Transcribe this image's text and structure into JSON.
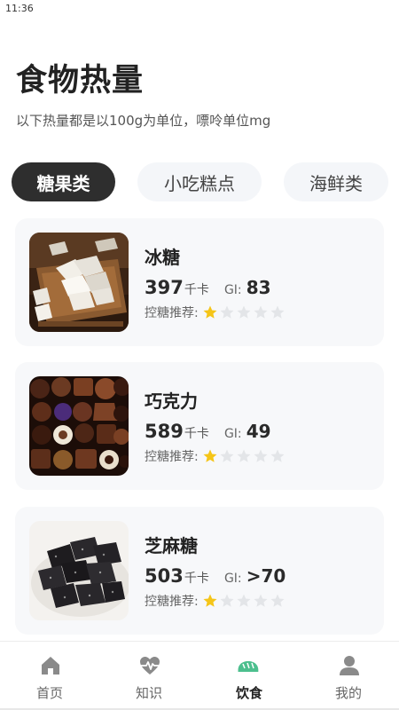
{
  "status_bar": {
    "time": "11:36"
  },
  "header": {
    "title": "食物热量",
    "subtitle": "以下热量都是以100g为单位，嘌呤单位mg"
  },
  "tabs": [
    {
      "label": "糖果类",
      "active": true
    },
    {
      "label": "小吃糕点",
      "active": false
    },
    {
      "label": "海鲜类",
      "active": false
    }
  ],
  "foods": [
    {
      "name": "冰糖",
      "kcal": "397",
      "kcal_unit": "千卡",
      "gi_label": "GI:",
      "gi": "83",
      "recommend_label": "控糖推荐:",
      "rating": 1,
      "rating_max": 5,
      "image": "rock-sugar-photo"
    },
    {
      "name": "巧克力",
      "kcal": "589",
      "kcal_unit": "千卡",
      "gi_label": "GI:",
      "gi": "49",
      "recommend_label": "控糖推荐:",
      "rating": 1,
      "rating_max": 5,
      "image": "chocolate-photo"
    },
    {
      "name": "芝麻糖",
      "kcal": "503",
      "kcal_unit": "千卡",
      "gi_label": "GI:",
      "gi": ">70",
      "recommend_label": "控糖推荐:",
      "rating": 1,
      "rating_max": 5,
      "image": "sesame-candy-photo"
    }
  ],
  "bottom_nav": [
    {
      "label": "首页",
      "icon": "home-icon",
      "active": false
    },
    {
      "label": "知识",
      "icon": "heartbeat-icon",
      "active": false
    },
    {
      "label": "饮食",
      "icon": "bread-icon",
      "active": true
    },
    {
      "label": "我的",
      "icon": "user-icon",
      "active": false
    }
  ],
  "colors": {
    "star_filled": "#f5c518",
    "star_empty": "#e3e5e8",
    "active_tab_bg": "#2e2e2e",
    "tab_bg": "#f4f6f9",
    "card_bg": "#f7f8fa",
    "nav_active_icon": "#4cbf8e",
    "nav_icon": "#8a8a8a"
  }
}
